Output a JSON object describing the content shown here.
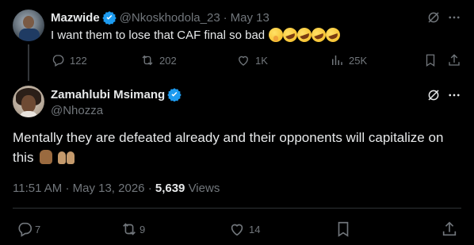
{
  "reply": {
    "name": "Mazwide",
    "handle": "@Nkoskhodola_23",
    "separator": "·",
    "date": "May 13",
    "text": "I want them to lose that CAF final so bad",
    "emojis": [
      "shushing-face",
      "rolling-on-floor-laughing",
      "rolling-on-floor-laughing",
      "rolling-on-floor-laughing",
      "rolling-on-floor-laughing"
    ],
    "stats": {
      "replies": "122",
      "reposts": "202",
      "likes": "1K",
      "views": "25K"
    }
  },
  "main": {
    "name": "Zamahlubi Msimang",
    "handle": "@Nhozza",
    "text": "Mentally they are defeated already and their opponents will capitalize on this",
    "emojis": [
      "hand-with-index-and-middle-fingers-crossed",
      "raising-hands"
    ],
    "time": "11:51 AM",
    "date_sep": "·",
    "date": "May 13, 2026",
    "meta_sep": "·",
    "views_count": "5,639",
    "views_label": "Views",
    "stats": {
      "replies": "7",
      "reposts": "9",
      "likes": "14"
    }
  },
  "colors": {
    "background": "#000000",
    "text": "#e7e9ea",
    "muted": "#71767b",
    "verified": "#1d9bf0",
    "divider": "#2f3336"
  }
}
